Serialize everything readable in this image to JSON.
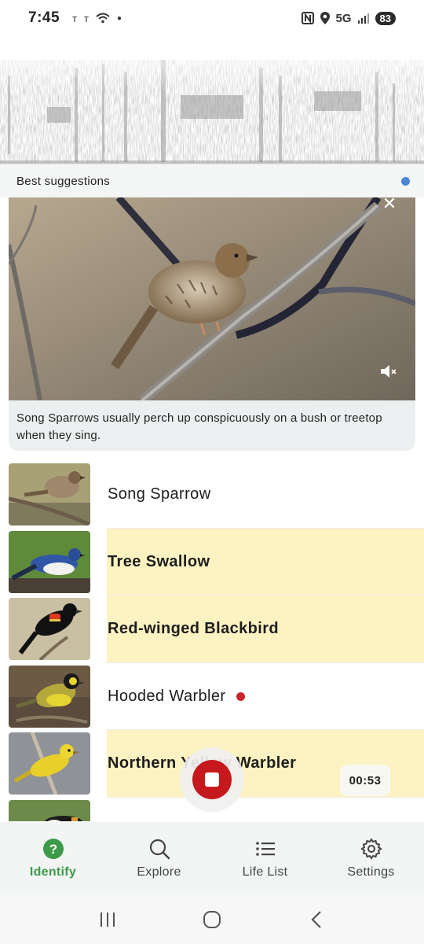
{
  "status_bar": {
    "time": "7:45",
    "network": "5G",
    "battery": "83"
  },
  "suggestions": {
    "title": "Best suggestions"
  },
  "photo_card": {
    "caption": "Song Sparrows usually perch up conspicuously on a bush or treetop when they sing."
  },
  "species": [
    {
      "name": "Song Sparrow",
      "highlighted": false,
      "new": false
    },
    {
      "name": "Tree Swallow",
      "highlighted": true,
      "new": false
    },
    {
      "name": "Red-winged Blackbird",
      "highlighted": true,
      "new": false
    },
    {
      "name": "Hooded Warbler",
      "highlighted": false,
      "new": true
    },
    {
      "name": "Northern Yellow Warbler",
      "highlighted": true,
      "new": false
    }
  ],
  "recording": {
    "timer": "00:53"
  },
  "bottom_nav": {
    "items": [
      {
        "label": "Identify",
        "icon": "help-circle-icon",
        "active": true
      },
      {
        "label": "Explore",
        "icon": "search-icon",
        "active": false
      },
      {
        "label": "Life List",
        "icon": "list-icon",
        "active": false
      },
      {
        "label": "Settings",
        "icon": "gear-icon",
        "active": false
      }
    ]
  },
  "colors": {
    "accent_green": "#3c9a49",
    "highlight_yellow": "#fdf3c2",
    "record_red": "#c5191d",
    "new_dot_red": "#c9262b",
    "indicator_blue": "#4a86d8"
  }
}
